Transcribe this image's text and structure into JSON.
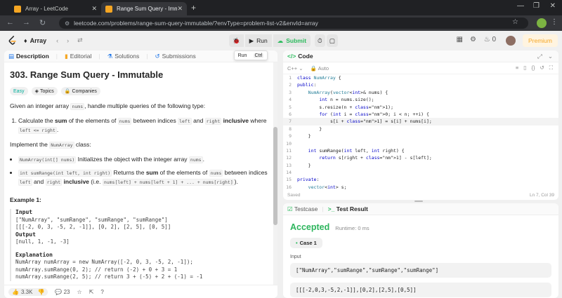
{
  "browser": {
    "tabs": [
      {
        "title": "Array - LeetCode",
        "active": false
      },
      {
        "title": "Range Sum Query - Immutable",
        "active": true
      }
    ],
    "url": "leetcode.com/problems/range-sum-query-immutable/?envType=problem-list-v2&envId=array"
  },
  "topbar": {
    "problem_list": "Array",
    "run_label": "Run",
    "submit_label": "Submit",
    "streak_count": "0",
    "premium_label": "Premium"
  },
  "tooltip": {
    "label": "Run",
    "key": "Ctrl"
  },
  "left_tabs": [
    "Description",
    "Editorial",
    "Solutions",
    "Submissions"
  ],
  "problem": {
    "title": "303. Range Sum Query - Immutable",
    "difficulty": "Easy",
    "topics_label": "Topics",
    "companies_label": "Companies",
    "intro": "Given an integer array nums, handle multiple queries of the following type:",
    "example_title": "Example 1:",
    "example_input_label": "Input",
    "example_input_1": "[\"NumArray\", \"sumRange\", \"sumRange\", \"sumRange\"]",
    "example_input_2": "[[[-2, 0, 3, -5, 2, -1]], [0, 2], [2, 5], [0, 5]]",
    "example_output_label": "Output",
    "example_output": "[null, 1, -1, -3]",
    "example_expl_label": "Explanation",
    "example_expl_1": "NumArray numArray = new NumArray([-2, 0, 3, -5, 2, -1]);",
    "example_expl_2": "numArray.sumRange(0, 2); // return (-2) + 0 + 3 = 1",
    "example_expl_3": "numArray.sumRange(2, 5); // return 3 + (-5) + 2 + (-1) = -1"
  },
  "left_footer": {
    "likes": "3.3K",
    "comments": "23"
  },
  "code": {
    "tab_label": "Code",
    "language": "C++",
    "mode": "Auto",
    "lines": [
      "class NumArray {",
      "public:",
      "    NumArray(vector<int>& nums) {",
      "        int n = nums.size();",
      "        s.resize(n + 1);",
      "        for (int i = 0; i < n; ++i) {",
      "            s[i + 1] = s[i] + nums[i];",
      "        }",
      "    }",
      "",
      "    int sumRange(int left, int right) {",
      "        return s[right + 1] - s[left];",
      "    }",
      "",
      "private:",
      "    vector<int> s;"
    ],
    "active_line": 7,
    "status_left": "Saved",
    "status_right": "Ln 7, Col 39"
  },
  "result": {
    "tabs": [
      "Testcase",
      "Test Result"
    ],
    "status": "Accepted",
    "runtime": "Runtime: 0 ms",
    "case_label": "Case 1",
    "input_label": "Input",
    "input_line_1": "[\"NumArray\",\"sumRange\",\"sumRange\",\"sumRange\"]",
    "input_line_2": "[[[-2,0,3,-5,2,-1]],[0,2],[2,5],[0,5]]"
  }
}
